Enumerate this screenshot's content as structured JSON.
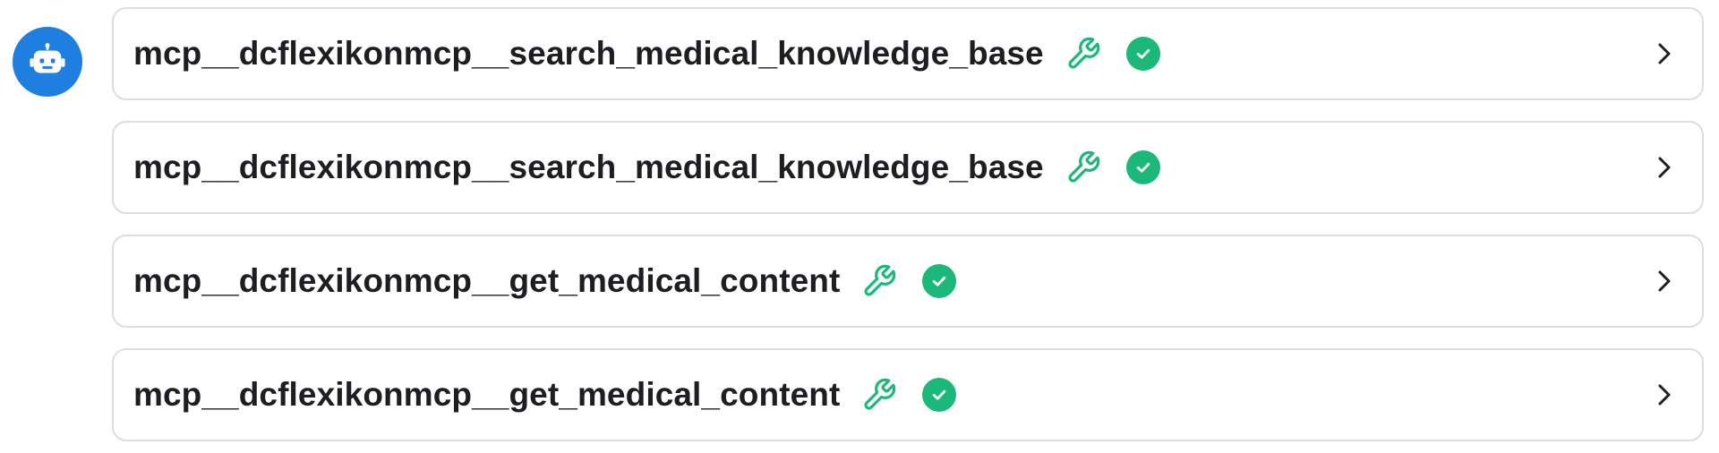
{
  "assistant": {
    "avatar_icon": "robot-icon",
    "avatar_color": "#1f7fe0"
  },
  "colors": {
    "tool_icon": "#1cb87a",
    "success": "#1cb87a",
    "border": "#dcdde0",
    "text": "#1d1d22"
  },
  "tool_calls": [
    {
      "name": "mcp__dcflexikonmcp__search_medical_knowledge_base",
      "tool_icon": "wrench-icon",
      "status": "success",
      "status_icon": "check-circle-icon",
      "expand_icon": "chevron-right-icon"
    },
    {
      "name": "mcp__dcflexikonmcp__search_medical_knowledge_base",
      "tool_icon": "wrench-icon",
      "status": "success",
      "status_icon": "check-circle-icon",
      "expand_icon": "chevron-right-icon"
    },
    {
      "name": "mcp__dcflexikonmcp__get_medical_content",
      "tool_icon": "wrench-icon",
      "status": "success",
      "status_icon": "check-circle-icon",
      "expand_icon": "chevron-right-icon"
    },
    {
      "name": "mcp__dcflexikonmcp__get_medical_content",
      "tool_icon": "wrench-icon",
      "status": "success",
      "status_icon": "check-circle-icon",
      "expand_icon": "chevron-right-icon"
    }
  ]
}
